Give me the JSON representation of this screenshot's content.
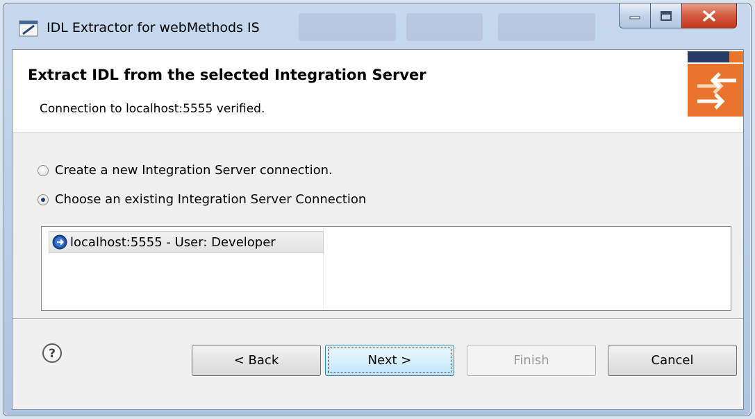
{
  "window": {
    "title": "IDL Extractor for webMethods IS"
  },
  "banner": {
    "title": "Extract IDL from the selected Integration Server",
    "message": "Connection to localhost:5555 verified."
  },
  "options": {
    "create_new_label": "Create a new Integration Server connection.",
    "choose_existing_label": "Choose an existing Integration Server Connection",
    "selected": "choose_existing"
  },
  "connections": {
    "items": [
      {
        "label": "localhost:5555 - User: Developer",
        "icon": "connection-icon"
      }
    ]
  },
  "buttons": {
    "back": "< Back",
    "next": "Next >",
    "finish": "Finish",
    "cancel": "Cancel"
  },
  "colors": {
    "accent_orange": "#e8752b",
    "brand_navy": "#263c64",
    "close_red": "#c2391c"
  }
}
